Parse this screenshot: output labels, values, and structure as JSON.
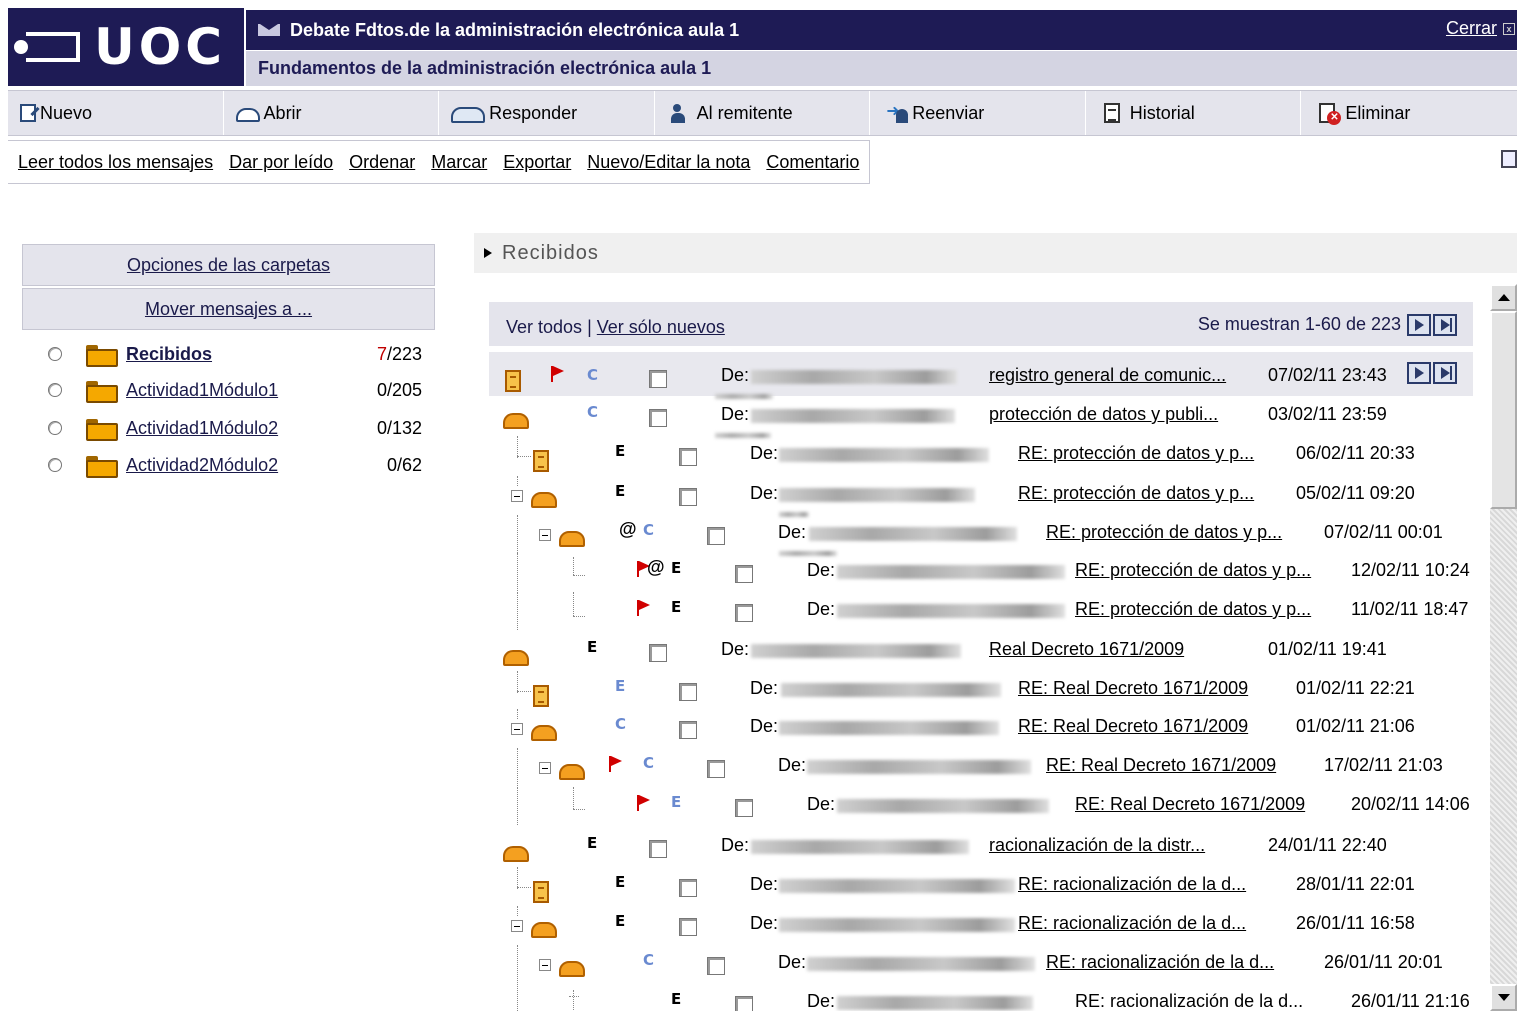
{
  "header": {
    "logo_text": "UOC",
    "title": "Debate Fdtos.de la administración electrónica aula 1",
    "subtitle": "Fundamentos de la administración electrónica aula 1",
    "close_label": "Cerrar"
  },
  "toolbar": {
    "buttons": [
      {
        "label": "Nuevo",
        "icon": "new-message-icon"
      },
      {
        "label": "Abrir",
        "icon": "open-envelope-icon"
      },
      {
        "label": "Responder",
        "icon": "reply-icon"
      },
      {
        "label": "Al remitente",
        "icon": "reply-sender-icon"
      },
      {
        "label": "Reenviar",
        "icon": "forward-icon"
      },
      {
        "label": "Historial",
        "icon": "history-icon"
      },
      {
        "label": "Eliminar",
        "icon": "delete-icon"
      }
    ]
  },
  "actions": [
    "Leer todos los mensajes",
    "Dar por leído",
    "Ordenar",
    "Marcar",
    "Exportar",
    "Nuevo/Editar la nota",
    "Comentario"
  ],
  "folders_panel": {
    "options_label": "Opciones de las carpetas",
    "move_label": "Mover mensajes a ...",
    "folders": [
      {
        "name": "Recibidos",
        "unread": "7",
        "total": "/223",
        "count": "7/223"
      },
      {
        "name": "Actividad1Módulo1",
        "count": "0/205"
      },
      {
        "name": "Actividad1Módulo2",
        "count": "0/132"
      },
      {
        "name": "Actividad2Módulo2",
        "count": "0/62"
      }
    ]
  },
  "main": {
    "section_title": "Recibidos",
    "view_all": "Ver todos",
    "separator": "|",
    "view_new": "Ver sólo nuevos",
    "range_text": "Se muestran 1-60 de 223",
    "de_label": "De:",
    "messages": [
      {
        "subject": "registro general de comunic...",
        "date": "07/02/11 23:43"
      },
      {
        "subject": "protección de datos y publi...",
        "date": "03/02/11 23:59"
      },
      {
        "subject": "RE: protección de datos y p...",
        "date": "06/02/11 20:33"
      },
      {
        "subject": "RE: protección de datos y p...",
        "date": "05/02/11 09:20"
      },
      {
        "subject": "RE: protección de datos y p...",
        "date": "07/02/11 00:01"
      },
      {
        "subject": "RE: protección de datos y p...",
        "date": "12/02/11 10:24"
      },
      {
        "subject": "RE: protección de datos y p...",
        "date": "11/02/11 18:47"
      },
      {
        "subject": "Real Decreto 1671/2009",
        "date": "01/02/11 19:41"
      },
      {
        "subject": "RE: Real Decreto 1671/2009",
        "date": "01/02/11 22:21"
      },
      {
        "subject": "RE: Real Decreto 1671/2009",
        "date": "01/02/11 21:06"
      },
      {
        "subject": "RE: Real Decreto 1671/2009",
        "date": "17/02/11 21:03"
      },
      {
        "subject": "RE: Real Decreto 1671/2009",
        "date": "20/02/11 14:06"
      },
      {
        "subject": "racionalización de la distr...",
        "date": "24/01/11 22:40"
      },
      {
        "subject": "RE: racionalización de la d...",
        "date": "28/01/11 22:01"
      },
      {
        "subject": "RE: racionalización de la d...",
        "date": "26/01/11 16:58"
      },
      {
        "subject": "RE: racionalización de la d...",
        "date": "26/01/11 20:01"
      },
      {
        "subject": "RE: racionalización de la d...",
        "date": "26/01/11 21:16"
      }
    ]
  }
}
